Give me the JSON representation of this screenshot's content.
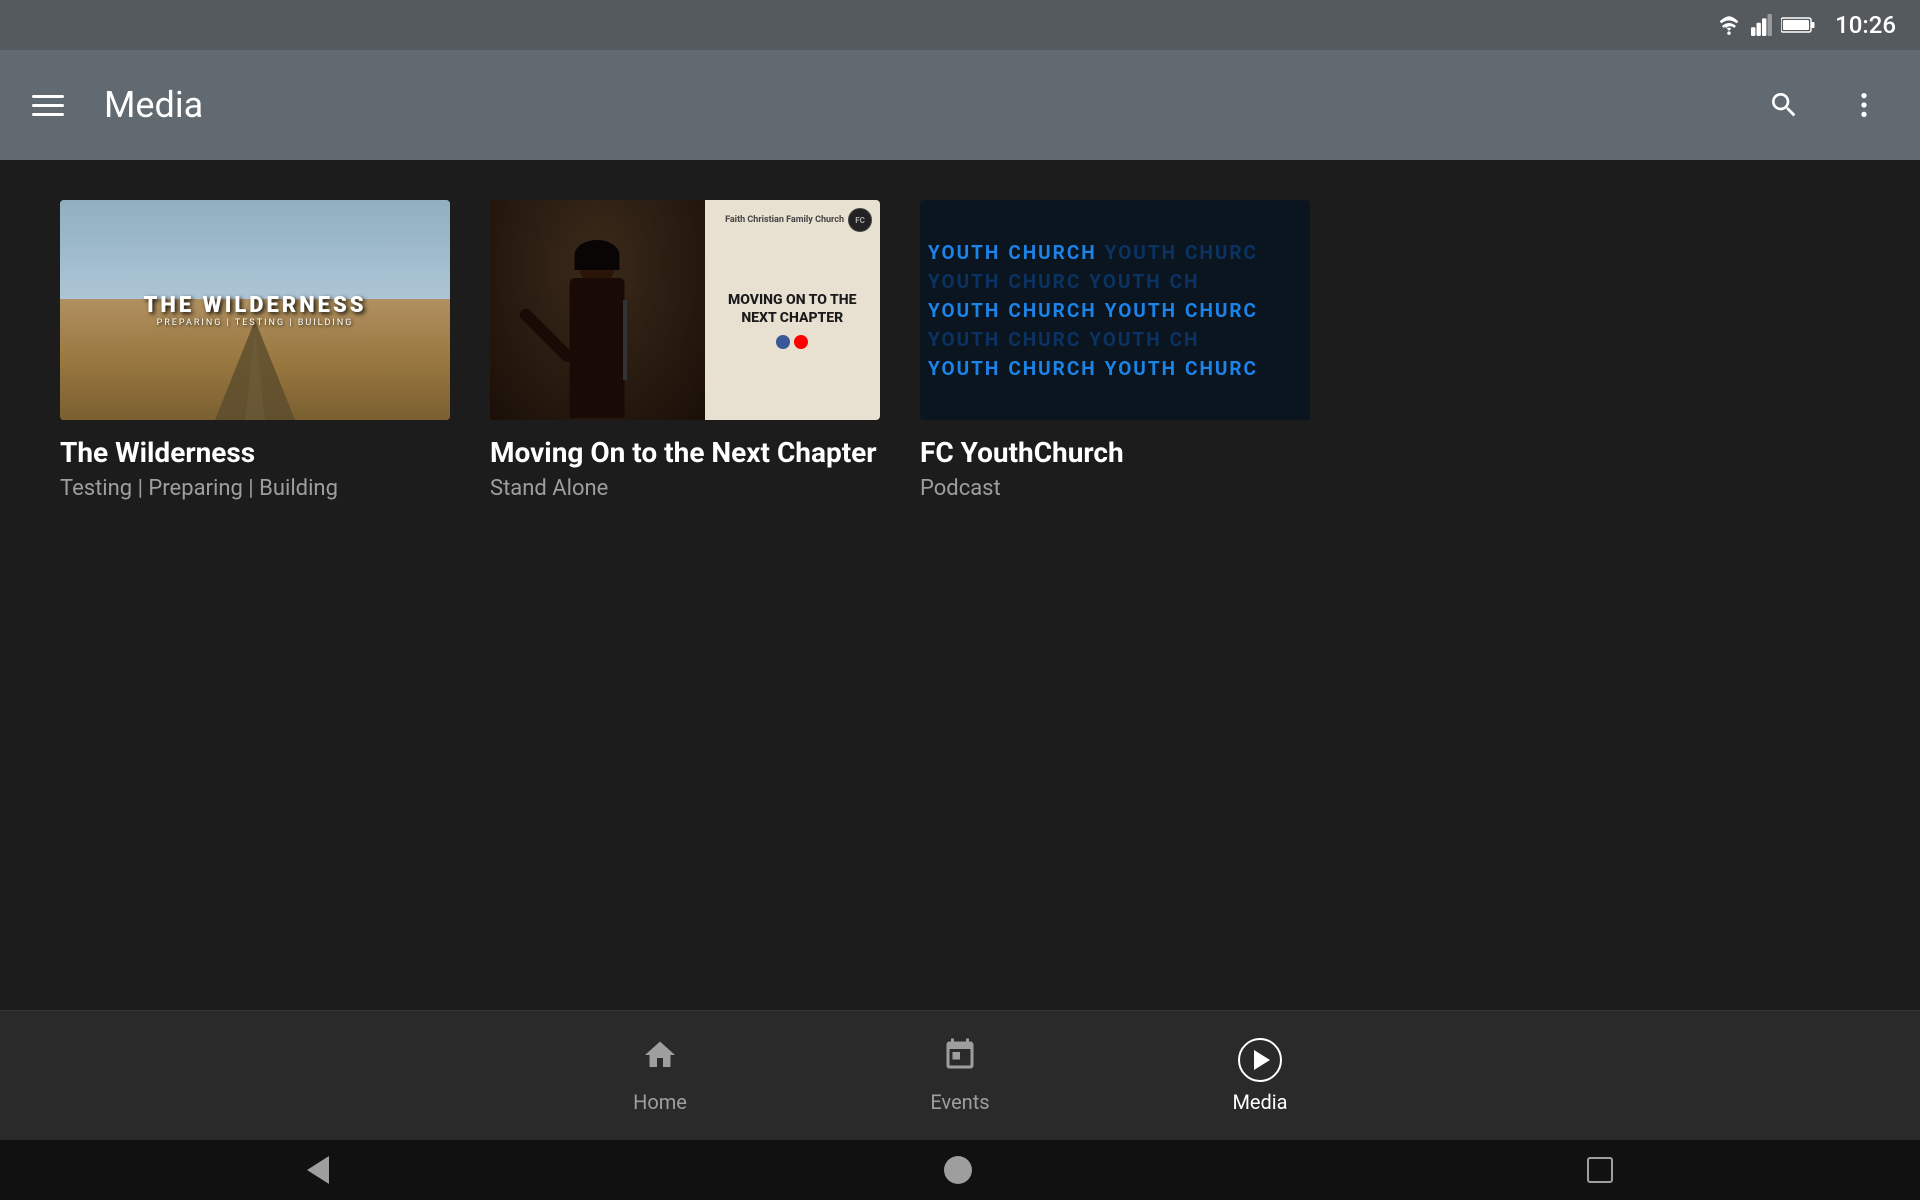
{
  "status_bar": {
    "time": "10:26"
  },
  "app_bar": {
    "title": "Media",
    "menu_label": "Menu",
    "search_label": "Search",
    "more_label": "More options"
  },
  "media_cards": [
    {
      "id": "wilderness",
      "title": "The Wilderness",
      "subtitle": "Testing | Preparing | Building",
      "thumb_type": "wilderness",
      "thumb_main": "THE WILDERNESS",
      "thumb_sub": "PREPARING | TESTING | BUILDING"
    },
    {
      "id": "moving-on",
      "title": "Moving On to the Next Chapter",
      "subtitle": "Stand Alone",
      "thumb_type": "moving",
      "thumb_text": "MOVING ON TO THE NEXT CHAPTER"
    },
    {
      "id": "youth-church",
      "title": "FC YouthChurch",
      "subtitle": "Podcast",
      "thumb_type": "youth",
      "thumb_text": "YOUTH CHURCH"
    }
  ],
  "bottom_nav": {
    "items": [
      {
        "id": "home",
        "label": "Home",
        "icon": "home",
        "active": false
      },
      {
        "id": "events",
        "label": "Events",
        "icon": "events",
        "active": false
      },
      {
        "id": "media",
        "label": "Media",
        "icon": "media",
        "active": true
      }
    ]
  },
  "system_nav": {
    "back_label": "Back",
    "home_label": "Home",
    "recent_label": "Recent"
  }
}
